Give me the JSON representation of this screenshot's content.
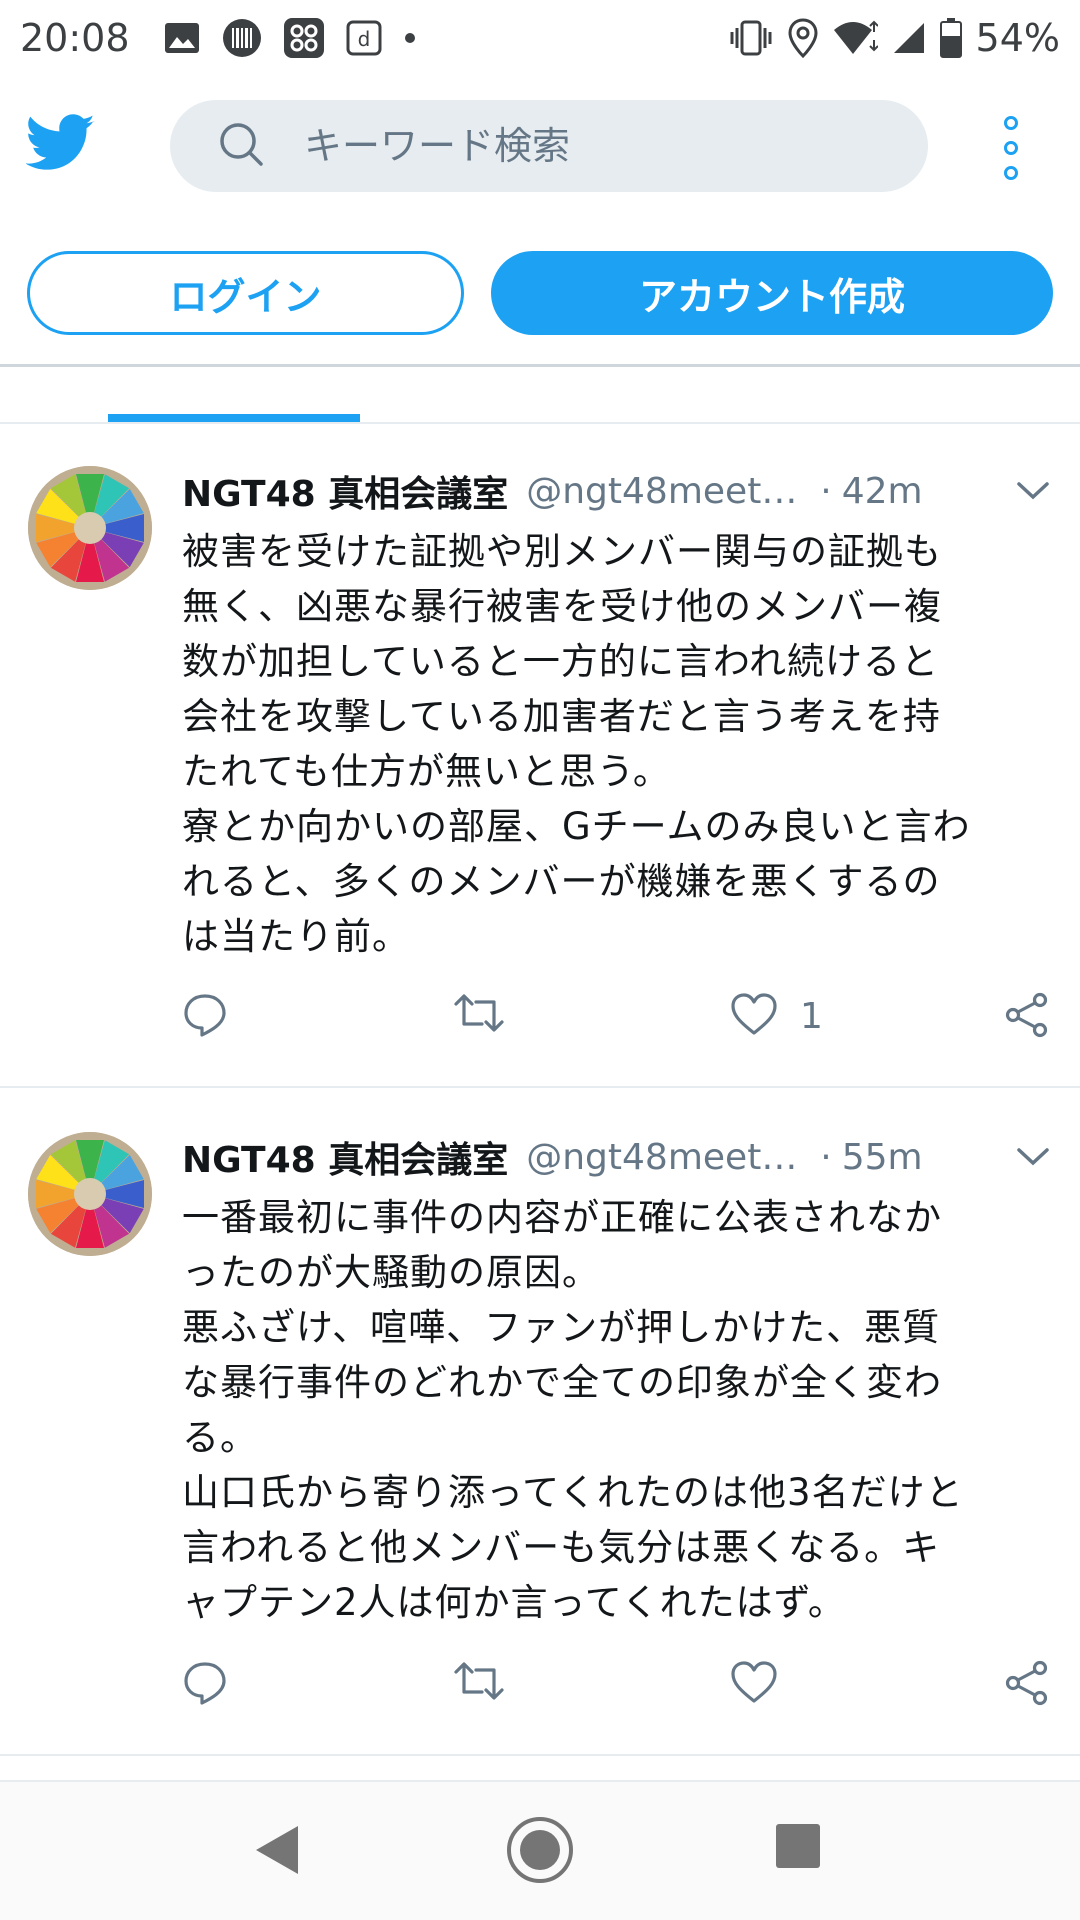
{
  "status_bar": {
    "time": "20:08",
    "battery": "54%",
    "left_icons": [
      "image-icon",
      "barcode-icon",
      "app-grid-icon",
      "music-note-icon",
      "dot-icon"
    ],
    "right_icons": [
      "vibrate-icon",
      "location-icon",
      "wifi-icon",
      "signal-icon",
      "battery-icon"
    ]
  },
  "header": {
    "logo": "twitter-bird-icon",
    "search_placeholder": "キーワード検索",
    "menu_icon": "kebab-menu-icon"
  },
  "auth": {
    "login_label": "ログイン",
    "signup_label": "アカウント作成"
  },
  "tweets": [
    {
      "name": "NGT48 真相会議室",
      "handle": "@ngt48meeti…",
      "separator": "·",
      "time": "42m",
      "text": "被害を受けた証拠や別メンバー関与の証拠も\n無く、凶悪な暴行被害を受け他のメンバー複\n数が加担していると一方的に言われ続けると\n会社を攻撃している加害者だと言う考えを持\nたれても仕方が無いと思う。\n寮とか向かいの部屋、Gチームのみ良いと言わ\nれると、多くのメンバーが機嫌を悪くするの\nは当たり前。",
      "like_count": "1"
    },
    {
      "name": "NGT48 真相会議室",
      "handle": "@ngt48meeti…",
      "separator": "·",
      "time": "55m",
      "text": "一番最初に事件の内容が正確に公表されなか\nったのが大騒動の原因。\n悪ふざけ、喧嘩、ファンが押しかけた、悪質\nな暴行事件のどれかで全ての印象が全く変わ\nる。\n山口氏から寄り添ってくれたのは他3名だけと\n言われると他メンバーも気分は悪くなる。キ\nャプテン2人は何か言ってくれたはず。",
      "like_count": ""
    }
  ],
  "colors": {
    "accent": "#1da1f2",
    "text": "#14171a",
    "secondary": "#657786",
    "search_bg": "#e6ecf0"
  }
}
